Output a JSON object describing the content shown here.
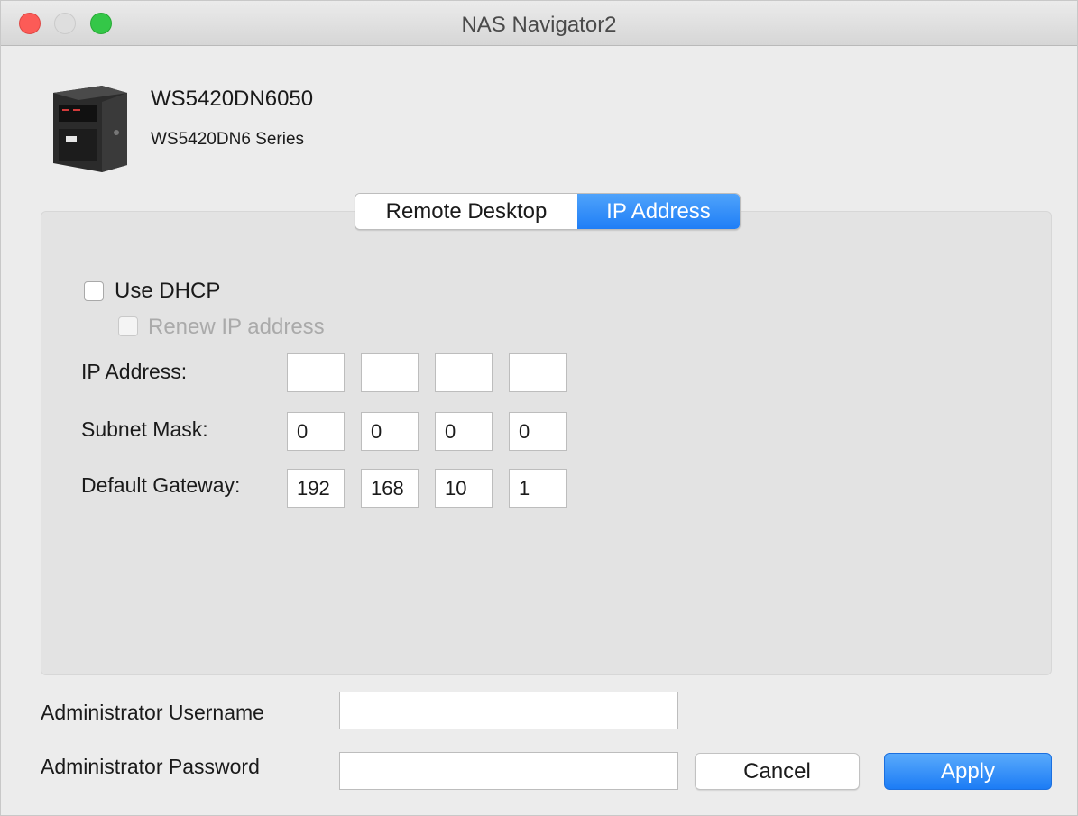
{
  "window": {
    "title": "NAS Navigator2"
  },
  "device": {
    "name": "WS5420DN6050",
    "series": "WS5420DN6 Series",
    "icon": "nas-device-icon"
  },
  "tabs": [
    {
      "label": "Remote Desktop",
      "selected": false
    },
    {
      "label": "IP Address",
      "selected": true
    }
  ],
  "dhcp": {
    "use_dhcp_label": "Use DHCP",
    "use_dhcp_checked": false,
    "renew_label": "Renew IP address",
    "renew_checked": false,
    "renew_enabled": false
  },
  "network": {
    "ip_label": "IP Address:",
    "ip": [
      "",
      "",
      "",
      ""
    ],
    "mask_label": "Subnet Mask:",
    "mask": [
      "0",
      "0",
      "0",
      "0"
    ],
    "gateway_label": "Default Gateway:",
    "gateway": [
      "192",
      "168",
      "10",
      "1"
    ]
  },
  "admin": {
    "username_label": "Administrator Username",
    "username_value": "",
    "password_label": "Administrator Password",
    "password_value": ""
  },
  "buttons": {
    "cancel": "Cancel",
    "apply": "Apply"
  },
  "colors": {
    "accent": "#1f7ef6",
    "close": "#fc5b57",
    "maximize": "#34c748"
  }
}
